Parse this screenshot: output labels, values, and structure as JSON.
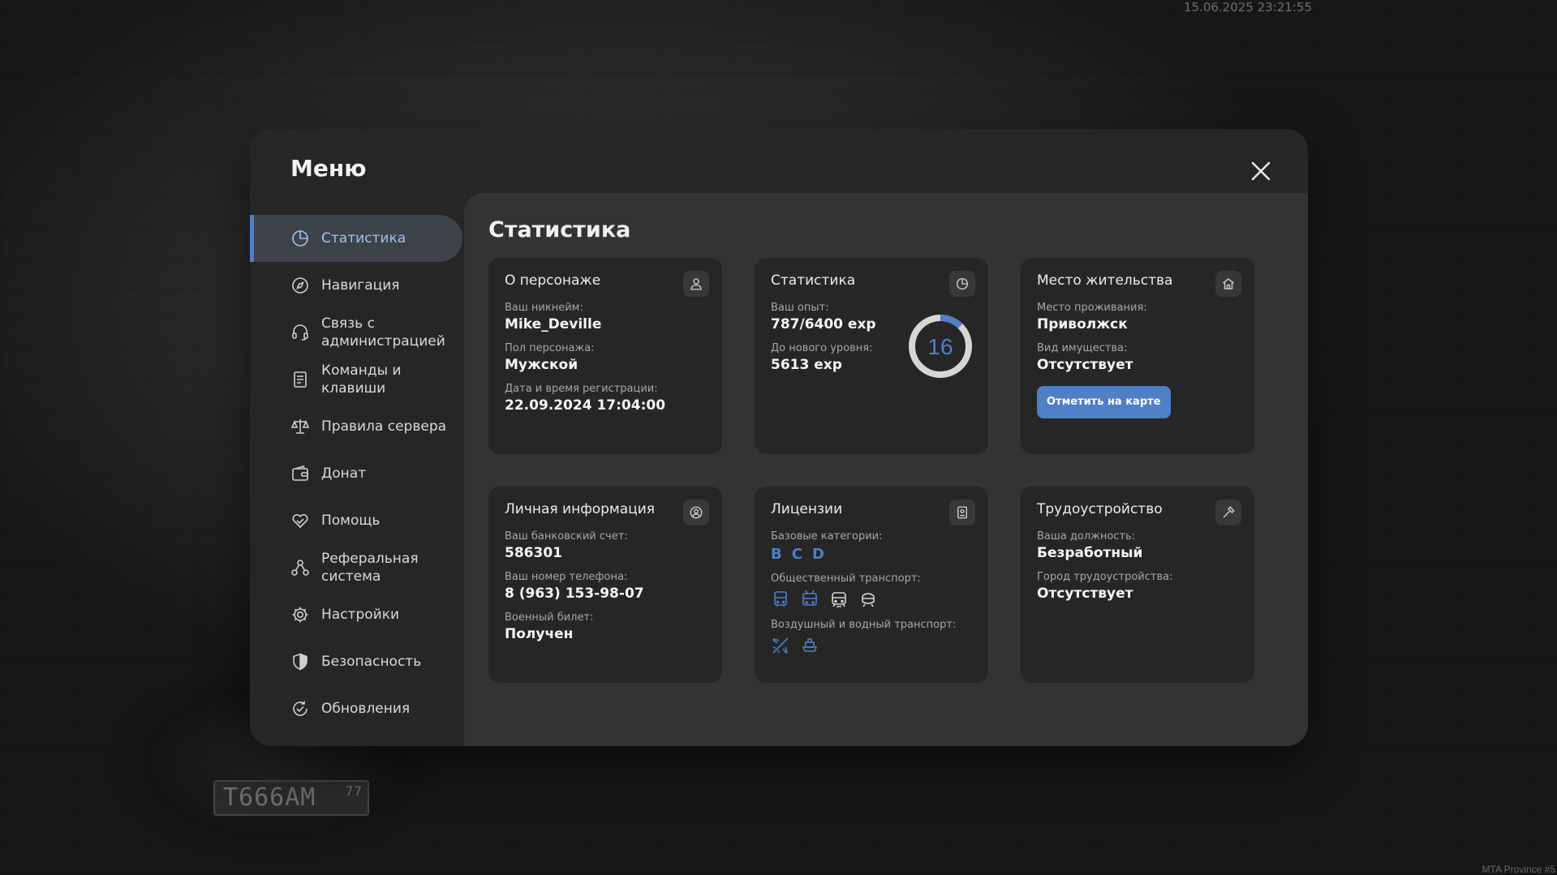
{
  "hud": {
    "datetime": "15.06.2025 23:21:55",
    "watermark": "MTA Province #5",
    "plate_number": "Т666АМ",
    "plate_region": "77"
  },
  "menu": {
    "title": "Меню",
    "close_icon": "close-icon"
  },
  "sidebar": {
    "items": [
      {
        "label": "Статистика",
        "icon": "stats-pie-icon",
        "active": true
      },
      {
        "label": "Навигация",
        "icon": "compass-icon"
      },
      {
        "label": "Связь с администрацией",
        "icon": "headset-icon"
      },
      {
        "label": "Команды и клавиши",
        "icon": "list-doc-icon"
      },
      {
        "label": "Правила сервера",
        "icon": "scales-icon"
      },
      {
        "label": "Донат",
        "icon": "wallet-icon"
      },
      {
        "label": "Помощь",
        "icon": "heart-hand-icon"
      },
      {
        "label": "Реферальная система",
        "icon": "network-icon"
      },
      {
        "label": "Настройки",
        "icon": "gear-icon"
      },
      {
        "label": "Безопасность",
        "icon": "shield-icon"
      },
      {
        "label": "Обновления",
        "icon": "refresh-check-icon"
      }
    ]
  },
  "content": {
    "title": "Статистика",
    "cards": {
      "character": {
        "title": "О персонаже",
        "nickname_label": "Ваш никнейм:",
        "nickname": "Mike_Deville",
        "gender_label": "Пол персонажа:",
        "gender": "Мужской",
        "reg_label": "Дата и время регистрации:",
        "reg_date": "22.09.2024 17:04:00"
      },
      "stats": {
        "title": "Статистика",
        "exp_label": "Ваш опыт:",
        "exp": "787/6400 exp",
        "next_label": "До нового уровня:",
        "next": "5613 exp",
        "level": "16",
        "progress": 0.123
      },
      "residence": {
        "title": "Место жительства",
        "place_label": "Место проживания:",
        "place": "Приволжск",
        "property_label": "Вид имущества:",
        "property": "Отсутствует",
        "button": "Отметить на карте"
      },
      "personal": {
        "title": "Личная информация",
        "bank_label": "Ваш банковский счет:",
        "bank": "586301",
        "phone_label": "Ваш номер телефона:",
        "phone": "8 (963) 153-98-07",
        "military_label": "Военный билет:",
        "military": "Получен"
      },
      "licenses": {
        "title": "Лицензии",
        "base_label": "Базовые категории:",
        "categories": [
          "B",
          "C",
          "D"
        ],
        "public_label": "Общественный транспорт:",
        "public_icons": [
          "bus-icon",
          "trolleybus-icon",
          "tram-icon",
          "train-icon"
        ],
        "air_label": "Воздушный и водный транспорт:",
        "air_icons": [
          "plane-icon",
          "boat-icon"
        ]
      },
      "job": {
        "title": "Трудоустройство",
        "position_label": "Ваша должность:",
        "position": "Безработный",
        "city_label": "Город трудоустройства:",
        "city": "Отсутствует"
      }
    }
  },
  "colors": {
    "accent": "#4f7fc7",
    "active_text": "#9ec3f4"
  }
}
